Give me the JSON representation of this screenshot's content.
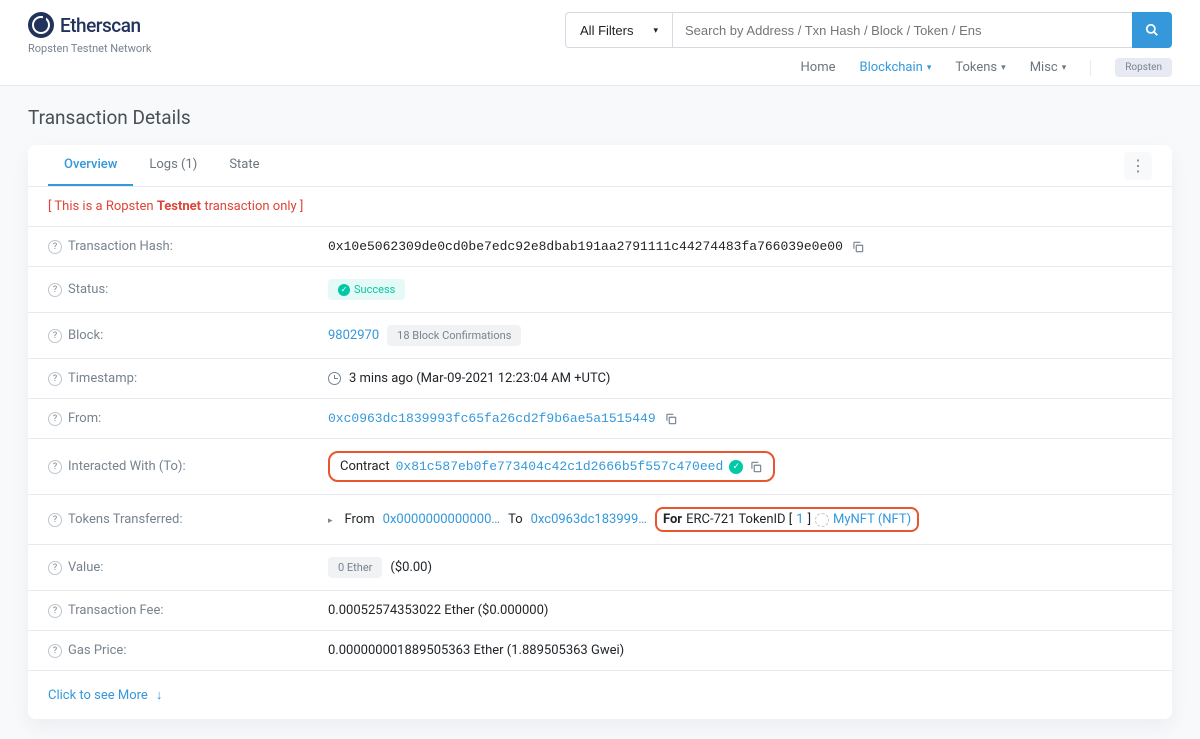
{
  "header": {
    "logo_text": "Etherscan",
    "network_label": "Ropsten Testnet Network",
    "filter_label": "All Filters",
    "search_placeholder": "Search by Address / Txn Hash / Block / Token / Ens",
    "nav": {
      "home": "Home",
      "blockchain": "Blockchain",
      "tokens": "Tokens",
      "misc": "Misc"
    },
    "ropsten_badge": "Ropsten"
  },
  "page_title": "Transaction Details",
  "tabs": {
    "overview": "Overview",
    "logs": "Logs (1)",
    "state": "State"
  },
  "notice": {
    "prefix": "[ This is a Ropsten ",
    "bold": "Testnet",
    "suffix": " transaction only ]"
  },
  "rows": {
    "txn_hash_label": "Transaction Hash:",
    "txn_hash_value": "0x10e5062309de0cd0be7edc92e8dbab191aa2791111c44274483fa766039e0e00",
    "status_label": "Status:",
    "status_value": "Success",
    "block_label": "Block:",
    "block_value": "9802970",
    "block_conf": "18 Block Confirmations",
    "timestamp_label": "Timestamp:",
    "timestamp_value": "3 mins ago (Mar-09-2021 12:23:04 AM +UTC)",
    "from_label": "From:",
    "from_value": "0xc0963dc1839993fc65fa26cd2f9b6ae5a1515449",
    "to_label": "Interacted With (To):",
    "to_prefix": "Contract",
    "to_value": "0x81c587eb0fe773404c42c1d2666b5f557c470eed",
    "tokens_label": "Tokens Transferred:",
    "tokens_from_label": "From",
    "tokens_from_value": "0x0000000000000…",
    "tokens_to_label": "To",
    "tokens_to_value": "0xc0963dc183999…",
    "tokens_for_label": "For",
    "tokens_erc": "ERC-721 TokenID [",
    "tokens_id": "1",
    "tokens_bracket": "]",
    "tokens_name": "MyNFT (NFT)",
    "value_label": "Value:",
    "value_badge": "0 Ether",
    "value_usd": "($0.00)",
    "fee_label": "Transaction Fee:",
    "fee_value": "0.00052574353022 Ether ($0.000000)",
    "gas_label": "Gas Price:",
    "gas_value": "0.000000001889505363 Ether (1.889505363 Gwei)",
    "see_more": "Click to see More"
  }
}
